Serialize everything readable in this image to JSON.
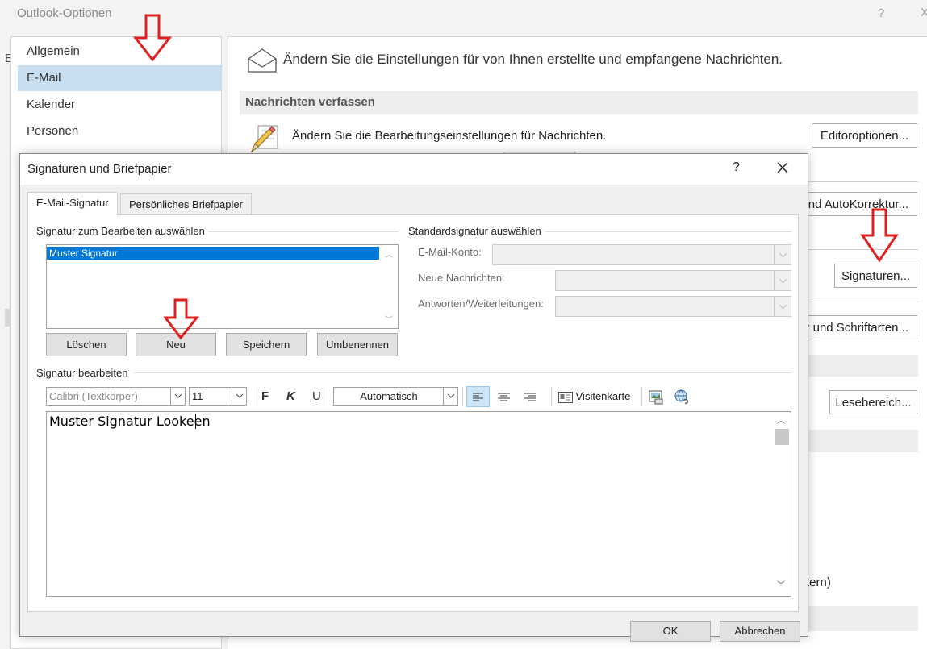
{
  "outer_window": {
    "title": "Outlook-Optionen",
    "help": "?",
    "edge_letter": "E"
  },
  "left_nav": {
    "items": [
      {
        "label": "Allgemein",
        "selected": false
      },
      {
        "label": "E-Mail",
        "selected": true
      },
      {
        "label": "Kalender",
        "selected": false
      },
      {
        "label": "Personen",
        "selected": false
      }
    ]
  },
  "main": {
    "header_text": "Ändern Sie die Einstellungen für von Ihnen erstellte und empfangene Nachrichten.",
    "section_title": "Nachrichten verfassen",
    "editor_settings_text": "Ändern Sie die Bearbeitungseinstellungen für Nachrichten.",
    "buttons": {
      "editor_options": "Editoroptionen...",
      "autocorrect_partial": "nd AutoKorrektur...",
      "signatures": "Signaturen...",
      "fonts_partial": "er und Schriftarten...",
      "reading_pane": "Lesebereich..."
    },
    "partial_text_bottom": "tern)"
  },
  "dialog": {
    "title": "Signaturen und Briefpapier",
    "help": "?",
    "tabs": {
      "email_signature": "E-Mail-Signatur",
      "personal_stationery": "Persönliches Briefpapier"
    },
    "select_signature_label": "Signatur zum Bearbeiten auswählen",
    "signature_list": [
      "Muster Signatur"
    ],
    "buttons": {
      "delete": "Löschen",
      "new": "Neu",
      "save": "Speichern",
      "rename": "Umbenennen"
    },
    "default_signature_label": "Standardsignatur auswählen",
    "email_account_label": "E-Mail-Konto:",
    "new_messages_label": "Neue Nachrichten:",
    "replies_label": "Antworten/Weiterleitungen:",
    "edit_signature_label": "Signatur bearbeiten",
    "toolbar": {
      "font": "Calibri (Textkörper)",
      "size": "11",
      "bold": "F",
      "italic": "K",
      "underline": "U",
      "color": "Automatisch",
      "business_card": "Visitenkarte"
    },
    "editor_content": "Muster Signatur Lookeen",
    "footer": {
      "ok": "OK",
      "cancel": "Abbrechen"
    }
  },
  "colors": {
    "selection": "#0078d7",
    "nav_selected": "#c7dff1",
    "annotation_arrow": "#e02020"
  }
}
